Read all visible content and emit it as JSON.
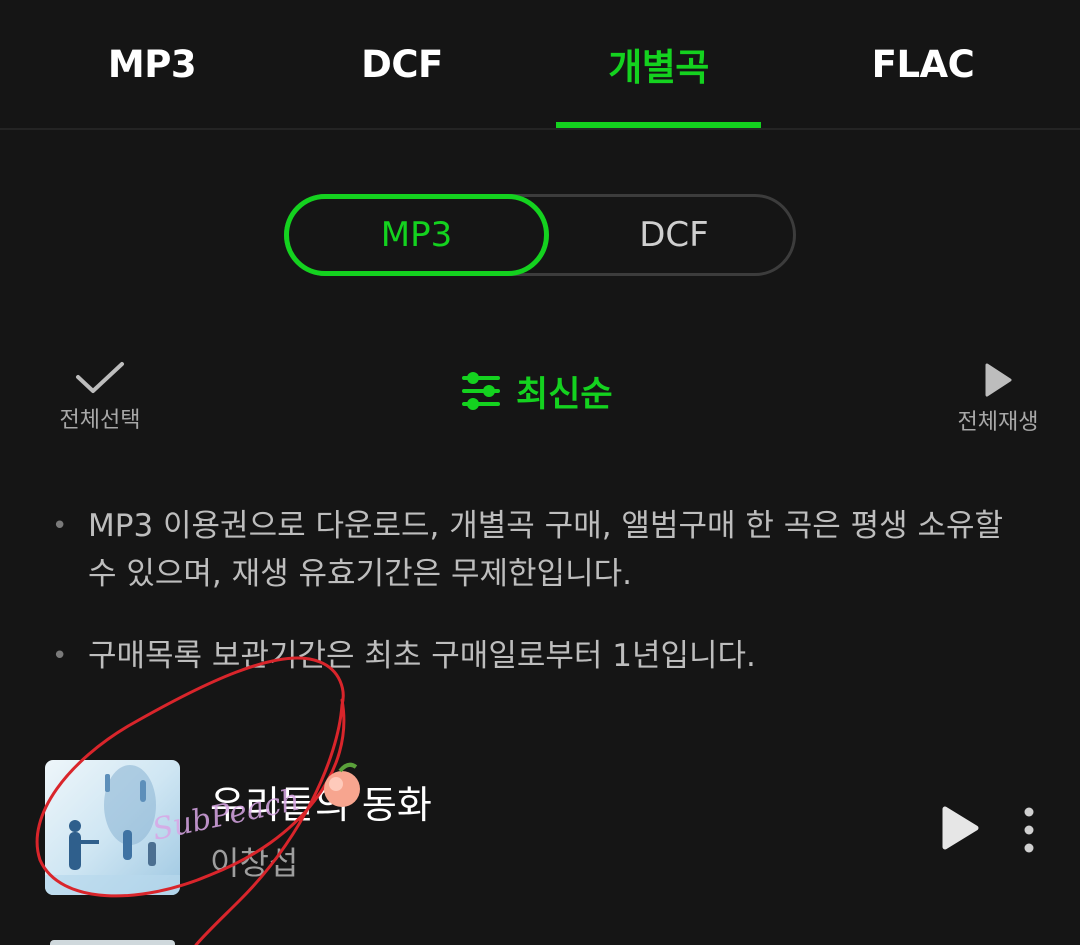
{
  "tabs": [
    {
      "label": "MP3"
    },
    {
      "label": "DCF"
    },
    {
      "label": "개별곡"
    },
    {
      "label": "FLAC"
    }
  ],
  "segment": {
    "options": [
      "MP3",
      "DCF"
    ],
    "selected": "MP3"
  },
  "toolbar": {
    "select_all_label": "전체선택",
    "sort_label": "최신순",
    "play_all_label": "전체재생"
  },
  "notices": [
    "MP3 이용권으로 다운로드, 개별곡 구매, 앨범구매 한 곡은 평생 소유할 수 있으며, 재생 유효기간은 무제한입니다.",
    "구매목록 보관기간은 최초 구매일로부터 1년입니다."
  ],
  "tracks": [
    {
      "title": "우리들의 동화",
      "artist": "이창섭"
    }
  ],
  "overlay": {
    "watermark": "SubPeach"
  },
  "colors": {
    "accent": "#14d21f",
    "background": "#151515",
    "text": "#ffffff",
    "muted": "#bdbdbd",
    "annotation": "#d9252b"
  },
  "icons": {
    "select_all": "check-icon",
    "sort": "sliders-icon",
    "play_all": "play-icon",
    "track_play": "play-icon",
    "track_more": "more-vertical-icon"
  }
}
